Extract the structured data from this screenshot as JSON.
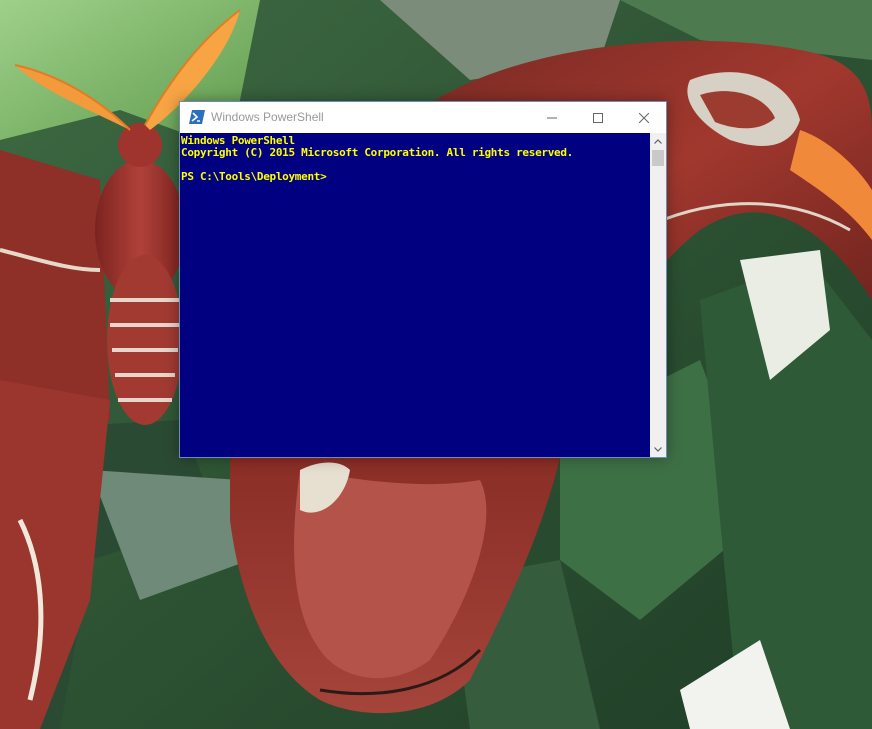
{
  "window": {
    "title": "Windows PowerShell",
    "icon": "powershell-icon",
    "controls": [
      "minimize-icon",
      "maximize-icon",
      "close-icon"
    ]
  },
  "console": {
    "background": "#000080",
    "text_color": "#ffff00",
    "lines": [
      "Windows PowerShell",
      "Copyright (C) 2015 Microsoft Corporation. All rights reserved.",
      "",
      "PS C:\\Tools\\Deployment>"
    ]
  },
  "scrollbar": {
    "up_icon": "scroll-up-icon",
    "down_icon": "scroll-down-icon"
  },
  "desktop": {
    "wallpaper": "moth-on-leaves"
  }
}
